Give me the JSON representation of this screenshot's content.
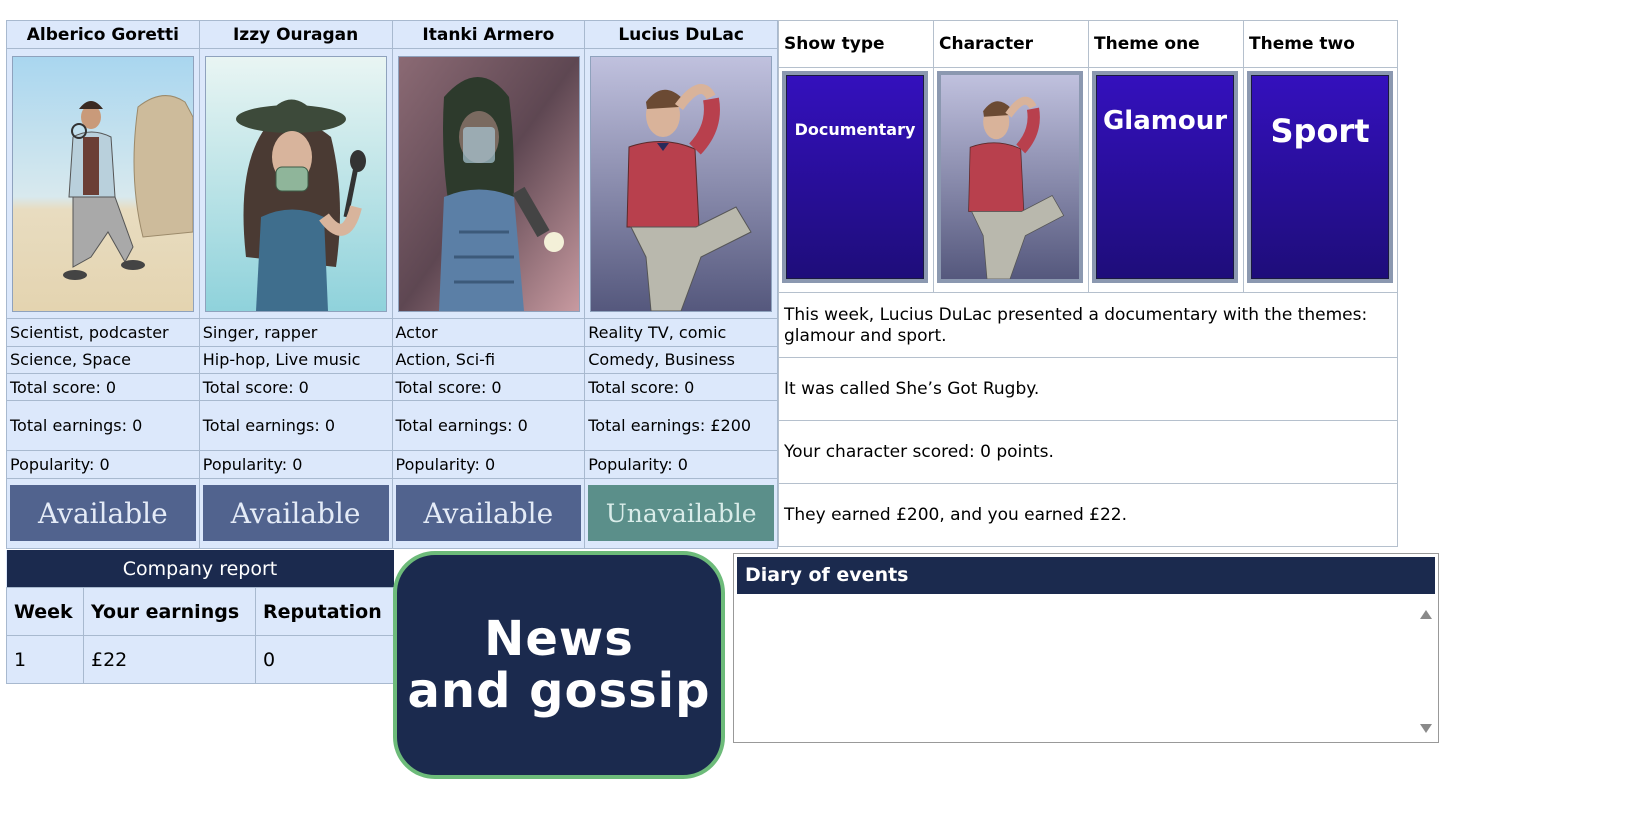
{
  "characters": [
    {
      "name": "Alberico Goretti",
      "portrait_icon": "scientist-portrait-icon",
      "roles": "Scientist, podcaster",
      "genres": "Science, Space",
      "total_score": "Total score: 0",
      "total_earnings": "Total earnings: 0",
      "popularity": "Popularity: 0",
      "status": "Available"
    },
    {
      "name": "Izzy Ouragan",
      "portrait_icon": "singer-portrait-icon",
      "roles": "Singer, rapper",
      "genres": "Hip-hop, Live music",
      "total_score": "Total score: 0",
      "total_earnings": "Total earnings: 0",
      "popularity": "Popularity: 0",
      "status": "Available"
    },
    {
      "name": "Itanki Armero",
      "portrait_icon": "actor-portrait-icon",
      "roles": "Actor",
      "genres": "Action, Sci-fi",
      "total_score": "Total score: 0",
      "total_earnings": "Total earnings: 0",
      "popularity": "Popularity: 0",
      "status": "Available"
    },
    {
      "name": "Lucius DuLac",
      "portrait_icon": "comedian-portrait-icon",
      "roles": "Reality TV, comic",
      "genres": "Comedy, Business",
      "total_score": "Total score: 0",
      "total_earnings": "Total earnings: £200",
      "popularity": "Popularity: 0",
      "status": "Unavailable"
    }
  ],
  "show": {
    "headers": [
      "Show type",
      "Character",
      "Theme one",
      "Theme two"
    ],
    "cards": {
      "show_type": "Documentary",
      "character_icon": "comedian-portrait-icon",
      "theme_one": "Glamour",
      "theme_two": "Sport"
    },
    "messages": [
      "This week, Lucius DuLac presented a documentary with the themes: glamour and sport.",
      "It was called She’s Got Rugby.",
      "Your character scored: 0 points.",
      "They earned £200, and you earned £22."
    ]
  },
  "report": {
    "title": "Company report",
    "headers": [
      "Week",
      "Your earnings",
      "Reputation"
    ],
    "rows": [
      [
        "1",
        "£22",
        "0"
      ]
    ]
  },
  "news_button": {
    "label": "News\nand gossip"
  },
  "diary": {
    "title": "Diary of events",
    "entries": []
  },
  "colors": {
    "panel_bg": "#dce8fb",
    "navy": "#1b2a4e",
    "available_btn": "#51638e",
    "unavailable_btn": "#5b8f8a",
    "card_blue": "#2a10a0",
    "news_border": "#6dbb7a"
  }
}
